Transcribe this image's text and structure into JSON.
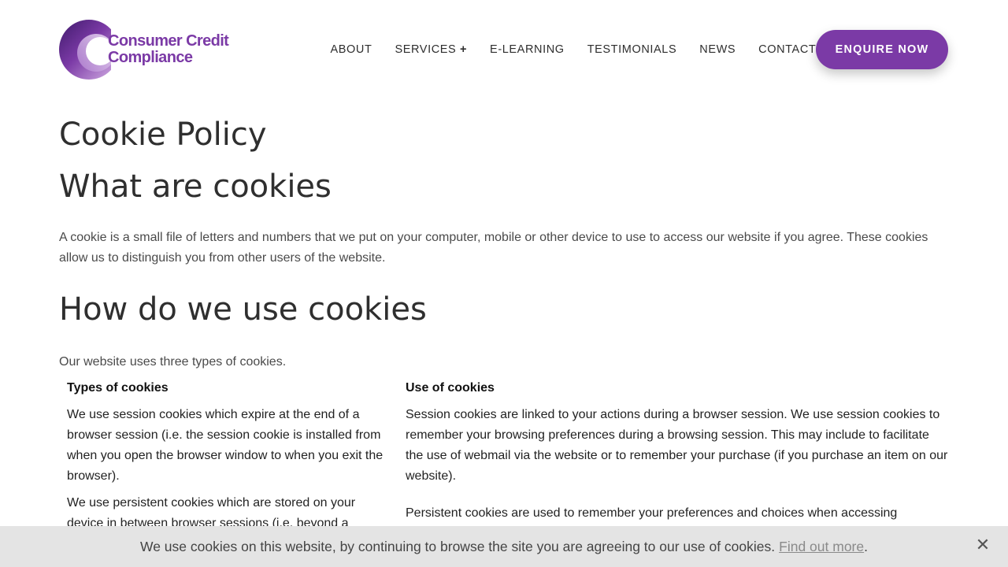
{
  "brand": {
    "name_line1": "Consumer Credit",
    "name_line2": "Compliance",
    "accent_color": "#7b3aa6"
  },
  "nav": {
    "items": [
      {
        "label": "ABOUT"
      },
      {
        "label": "SERVICES"
      },
      {
        "label": "E-LEARNING"
      },
      {
        "label": "TESTIMONIALS"
      },
      {
        "label": "NEWS"
      },
      {
        "label": "CONTACT"
      }
    ],
    "services_expand_symbol": "+",
    "cta_label": "ENQUIRE NOW"
  },
  "page": {
    "title": "Cookie Policy",
    "section1_heading": "What are cookies",
    "section1_text": "A cookie is a small file of letters and numbers that we put on your computer, mobile or other device to use to access our website if you agree. These cookies allow us to distinguish you from other users of the website.",
    "section2_heading": "How do we use cookies",
    "section2_text": "Our website uses three types of cookies."
  },
  "table": {
    "headers": [
      "Types of cookies",
      "Use of cookies"
    ],
    "left": [
      "We use session cookies which expire at the end of a browser session (i.e. the session cookie is installed from when you open the browser window to when you exit the browser).",
      "We use persistent cookies which are stored on your device in between browser sessions (i.e. beyond a"
    ],
    "right": [
      "Session cookies are linked to your actions during a browser session. We use session cookies to remember your browsing preferences during a browsing session. This may include to facilitate the use of webmail via the website or to remember your purchase (if you purchase an item on our website).",
      "Persistent cookies are used to remember your preferences and choices when accessing"
    ]
  },
  "cookie_banner": {
    "text": "We use cookies on this website, by continuing to browse the site you are agreeing to our use of cookies.",
    "link_label": "Find out more",
    "trailing": ".",
    "close_symbol": "✕"
  }
}
